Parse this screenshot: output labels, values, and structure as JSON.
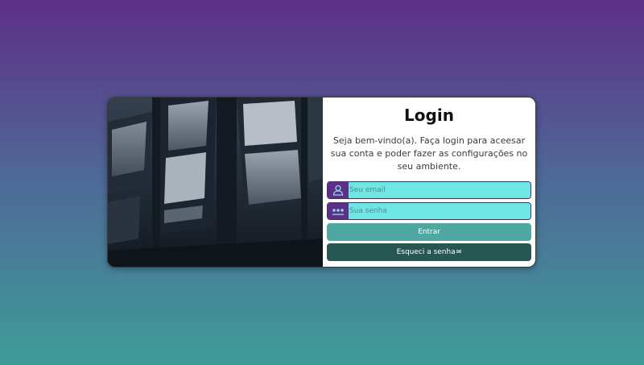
{
  "login": {
    "title": "Login",
    "subtitle": "Seja bem-vindo(a). Faça login para aceesar sua conta e poder fazer as configurações no seu ambiente.",
    "email": {
      "placeholder": "Seu email",
      "value": "",
      "icon": "user-icon"
    },
    "password": {
      "placeholder": "Sua senha",
      "value": "",
      "icon": "password-dots-icon"
    },
    "submit_label": "Entrar",
    "forgot_label": "Esqueci a senha",
    "forgot_icon": "✉"
  },
  "colors": {
    "primary_purple": "#5e2f86",
    "input_cyan": "#6ee6e4",
    "button_teal": "#4fa8a2",
    "button_dark_teal": "#275753"
  }
}
